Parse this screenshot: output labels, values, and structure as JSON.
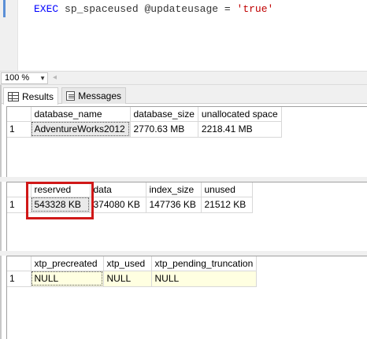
{
  "editor": {
    "keyword": "EXEC",
    "procedure": "sp_spaceused",
    "parameter": "@updateusage",
    "operator": "=",
    "value": "'true'"
  },
  "zoom": {
    "value": "100 %"
  },
  "tabs": [
    {
      "label": "Results",
      "icon": "grid-icon",
      "active": true
    },
    {
      "label": "Messages",
      "icon": "messages-icon",
      "active": false
    }
  ],
  "results": [
    {
      "columns": [
        "database_name",
        "database_size",
        "unallocated space"
      ],
      "rows": [
        {
          "num": "1",
          "cells": [
            "AdventureWorks2012",
            "2770.63 MB",
            "2218.41 MB"
          ]
        }
      ]
    },
    {
      "columns": [
        "reserved",
        "data",
        "index_size",
        "unused"
      ],
      "rows": [
        {
          "num": "1",
          "cells": [
            "543328 KB",
            "374080 KB",
            "147736 KB",
            "21512 KB"
          ]
        }
      ]
    },
    {
      "columns": [
        "xtp_precreated",
        "xtp_used",
        "xtp_pending_truncation"
      ],
      "rows": [
        {
          "num": "1",
          "cells": [
            "NULL",
            "NULL",
            "NULL"
          ]
        }
      ]
    }
  ],
  "colors": {
    "highlight": "#d01818",
    "keyword": "#0000ff",
    "string": "#c00000"
  }
}
